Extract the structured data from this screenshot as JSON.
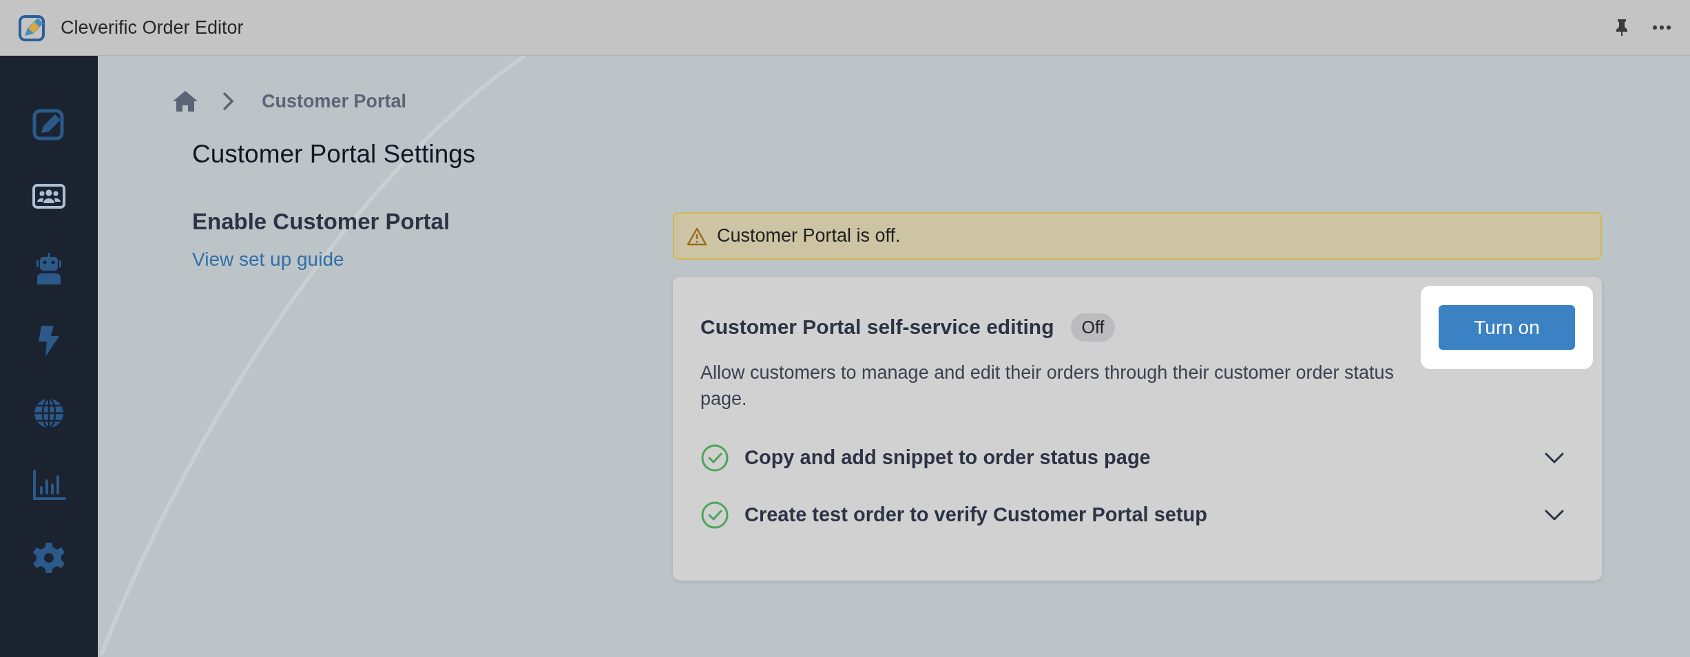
{
  "window": {
    "title": "Cleverific Order Editor"
  },
  "sidebar": {
    "items": [
      {
        "kind": "editor",
        "selected": false
      },
      {
        "kind": "customers",
        "selected": true
      },
      {
        "kind": "robot",
        "selected": false
      },
      {
        "kind": "bolt",
        "selected": false
      },
      {
        "kind": "globe",
        "selected": false
      },
      {
        "kind": "chart",
        "selected": false
      },
      {
        "kind": "settings",
        "selected": false
      }
    ]
  },
  "breadcrumb": {
    "current": "Customer Portal"
  },
  "page": {
    "title": "Customer Portal Settings"
  },
  "section": {
    "heading": "Enable Customer Portal",
    "link": "View set up guide"
  },
  "alert": {
    "kind": "warning",
    "message": "Customer Portal is off."
  },
  "feature": {
    "title": "Customer Portal self-service editing",
    "status": "Off",
    "on": false,
    "description": "Allow customers to manage and edit their orders through their customer order status page.",
    "button": "Turn on",
    "highlighted": true
  },
  "steps": [
    {
      "label": "Copy and add snippet to order status page",
      "done": true,
      "expanded": false
    },
    {
      "label": "Create test order to verify Customer Portal setup",
      "done": true,
      "expanded": false
    }
  ]
}
